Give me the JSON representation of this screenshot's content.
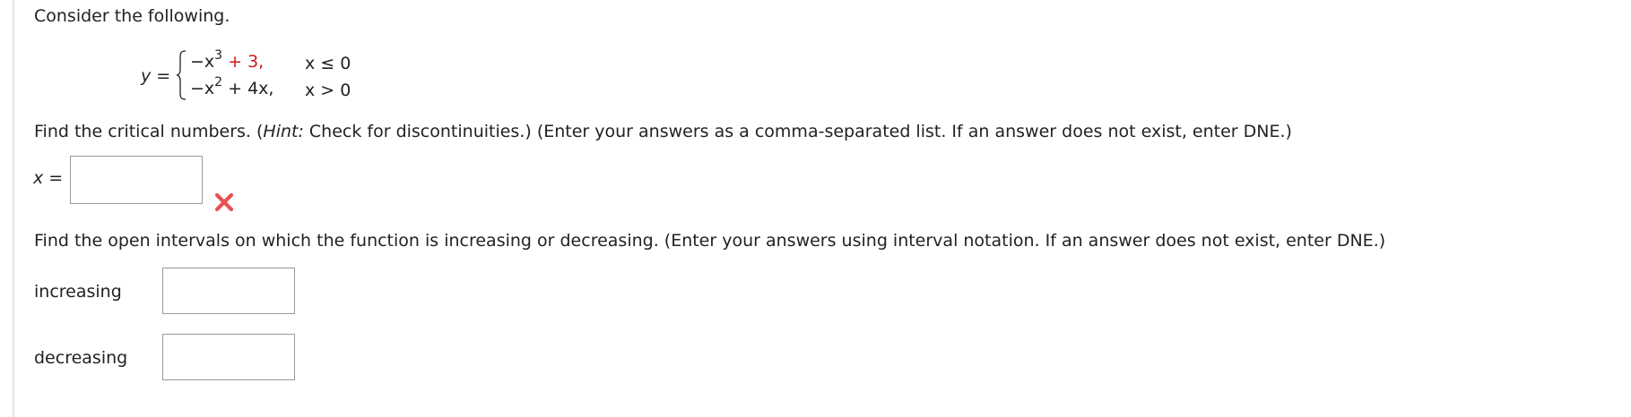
{
  "intro": "Consider the following.",
  "function": {
    "lhs": "y =",
    "piece1": {
      "term": "−x",
      "exp": "3",
      "rest": " + 3,",
      "rest_highlight": true
    },
    "piece2": {
      "term": "−x",
      "exp": "2",
      "rest": " + 4x,"
    },
    "cond1": "x ≤ 0",
    "cond2": "x > 0"
  },
  "question1": {
    "before_hint": "Find the critical numbers. (",
    "hint_label": "Hint:",
    "after_hint": " Check for discontinuities.) (Enter your answers as a comma-separated list. If an answer does not exist, enter DNE.)",
    "answer_label": "x =",
    "answer_value": "",
    "status_icon": "x-mark-icon",
    "status_color": "#e8524f"
  },
  "question2": {
    "text": "Find the open intervals on which the function is increasing or decreasing. (Enter your answers using interval notation. If an answer does not exist, enter DNE.)",
    "increasing_label": "increasing",
    "increasing_value": "",
    "decreasing_label": "decreasing",
    "decreasing_value": ""
  },
  "colors": {
    "highlight_red": "#cc1b1b",
    "text": "#222222",
    "input_border": "#9a9a9a"
  }
}
